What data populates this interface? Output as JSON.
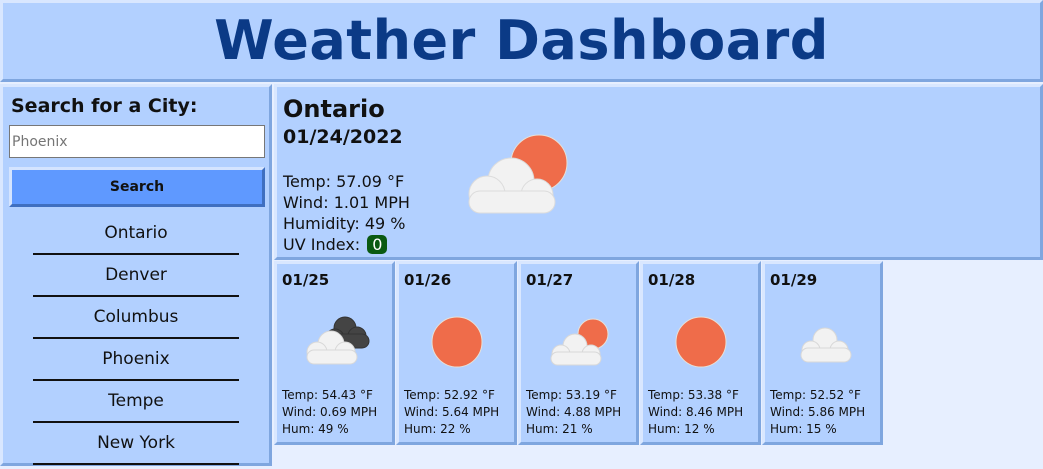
{
  "header": {
    "title": "Weather Dashboard"
  },
  "sidebar": {
    "title": "Search for a City:",
    "search_placeholder": "Phoenix",
    "search_button": "Search",
    "cities": [
      "Ontario",
      "Denver",
      "Columbus",
      "Phoenix",
      "Tempe",
      "New York"
    ]
  },
  "current": {
    "city": "Ontario",
    "date": "01/24/2022",
    "temp": "Temp: 57.09 °F",
    "wind": "Wind: 1.01 MPH",
    "humidity": "Humidity: 49 %",
    "uv_label": "UV Index:",
    "uv_value": "0",
    "icon": "partly-cloudy-icon"
  },
  "forecast": [
    {
      "date": "01/25",
      "icon": "storm-cloud-icon",
      "temp": "Temp: 54.43 °F",
      "wind": "Wind: 0.69 MPH",
      "hum": "Hum: 49 %"
    },
    {
      "date": "01/26",
      "icon": "sun-icon",
      "temp": "Temp: 52.92 °F",
      "wind": "Wind: 5.64 MPH",
      "hum": "Hum: 22 %"
    },
    {
      "date": "01/27",
      "icon": "partly-cloudy-icon",
      "temp": "Temp: 53.19 °F",
      "wind": "Wind: 4.88 MPH",
      "hum": "Hum: 21 %"
    },
    {
      "date": "01/28",
      "icon": "sun-icon",
      "temp": "Temp: 53.38 °F",
      "wind": "Wind: 8.46 MPH",
      "hum": "Hum: 12 %"
    },
    {
      "date": "01/29",
      "icon": "cloud-icon",
      "temp": "Temp: 52.52 °F",
      "wind": "Wind: 5.86 MPH",
      "hum": "Hum: 15 %"
    }
  ],
  "colors": {
    "uv_badge": "#0a5a12",
    "sun": "#ef6c4a",
    "cloud": "#f2f2f2",
    "dark_cloud": "#444444",
    "title": "#0b3a86"
  }
}
